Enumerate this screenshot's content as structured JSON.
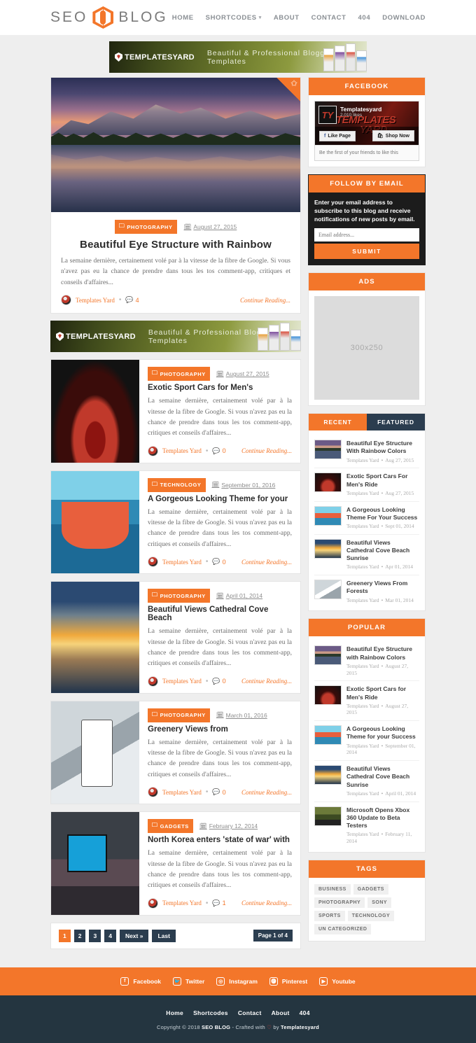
{
  "header": {
    "logo_left": "SEO",
    "logo_right": "BLOG",
    "logo_icon": "hexagon-icon",
    "nav": [
      {
        "label": "HOME",
        "has_caret": false
      },
      {
        "label": "SHORTCODES",
        "has_caret": true
      },
      {
        "label": "ABOUT",
        "has_caret": false
      },
      {
        "label": "CONTACT",
        "has_caret": false
      },
      {
        "label": "404",
        "has_caret": false
      },
      {
        "label": "DOWNLOAD",
        "has_caret": false
      }
    ]
  },
  "banner": {
    "brand": "TEMPLATESYARD",
    "tagline": "Beautiful & Professional Blogger Templates"
  },
  "featured_post": {
    "badge_icon": "star-icon",
    "category": "PHOTOGRAPHY",
    "date": "August 27, 2015",
    "title": "Beautiful Eye Structure with Rainbow",
    "excerpt": "La semaine dernière, certainement volé par à la vitesse de la fibre de Google. Si vous n'avez pas eu la chance de prendre dans tous les tos comment-app, critiques et conseils d'affaires...",
    "author": "Templates Yard",
    "comments": "4",
    "continue": "Continue Reading..."
  },
  "posts": [
    {
      "category": "PHOTOGRAPHY",
      "date": "August 27, 2015",
      "title": "Exotic Sport Cars for Men's",
      "excerpt": "La semaine dernière, certainement volé par à la vitesse de la fibre de Google. Si vous n'avez pas eu la chance de prendre dans tous les tos comment-app, critiques et conseils d'affaires...",
      "author": "Templates Yard",
      "comments": "0",
      "continue": "Continue Reading...",
      "thumb": "th-car"
    },
    {
      "category": "TECHNOLOGY",
      "date": "September 01, 2016",
      "title": "A Gorgeous Looking Theme for your",
      "excerpt": "La semaine dernière, certainement volé par à la vitesse de la fibre de Google. Si vous n'avez pas eu la chance de prendre dans tous les tos comment-app, critiques et conseils d'affaires...",
      "author": "Templates Yard",
      "comments": "0",
      "continue": "Continue Reading...",
      "thumb": "th-boat"
    },
    {
      "category": "PHOTOGRAPHY",
      "date": "April 01, 2014",
      "title": "Beautiful Views Cathedral Cove Beach",
      "excerpt": "La semaine dernière, certainement volé par à la vitesse de la fibre de Google. Si vous n'avez pas eu la chance de prendre dans tous les tos comment-app, critiques et conseils d'affaires...",
      "author": "Templates Yard",
      "comments": "0",
      "continue": "Continue Reading...",
      "thumb": "th-sun"
    },
    {
      "category": "PHOTOGRAPHY",
      "date": "March 01, 2016",
      "title": "Greenery Views from",
      "excerpt": "La semaine dernière, certainement volé par à la vitesse de la fibre de Google. Si vous n'avez pas eu la chance de prendre dans tous les tos comment-app, critiques et conseils d'affaires...",
      "author": "Templates Yard",
      "comments": "0",
      "continue": "Continue Reading...",
      "thumb": "th-phone"
    },
    {
      "category": "GADGETS",
      "date": "February 12, 2014",
      "title": "North Korea enters 'state of war' with",
      "excerpt": "La semaine dernière, certainement volé par à la vitesse de la fibre de Google. Si vous n'avez pas eu la chance de prendre dans tous les tos comment-app, critiques et conseils d'affaires...",
      "author": "Templates Yard",
      "comments": "1",
      "continue": "Continue Reading...",
      "thumb": "th-room"
    }
  ],
  "pagination": {
    "pages": [
      "1",
      "2",
      "3",
      "4"
    ],
    "next_label": "Next »",
    "last_label": "Last",
    "status": "Page 1 of 4",
    "active_page": "1"
  },
  "sidebar": {
    "facebook": {
      "title": "FACEBOOK",
      "page_name": "Templatesyard",
      "likes": "2,010 likes",
      "cover_text_1": "TEMPLATES",
      "cover_text_2": "YARD.",
      "like_button": "Like Page",
      "shop_button": "Shop Now",
      "footer_note": "Be the first of your friends to like this"
    },
    "follow_email": {
      "title": "FOLLOW BY EMAIL",
      "description": "Enter your email address to subscribe to this blog and receive notifications of new posts by email.",
      "input_placeholder": "Email address...",
      "submit_label": "SUBMIT"
    },
    "ads": {
      "title": "ADS",
      "placeholder": "300x250"
    },
    "tabs": {
      "recent_label": "RECENT",
      "featured_label": "FEATURED",
      "active": "RECENT",
      "items": [
        {
          "title": "Beautiful Eye Structure With Rainbow Colors",
          "author": "Templates Yard",
          "date": "Aug 27, 2015",
          "thumb": "mt-mountain"
        },
        {
          "title": "Exotic Sport Cars For Men's Ride",
          "author": "Templates Yard",
          "date": "Aug 27, 2015",
          "thumb": "mt-car"
        },
        {
          "title": "A Gorgeous Looking Theme For Your Success",
          "author": "Templates Yard",
          "date": "Sept 01, 2014",
          "thumb": "mt-boat"
        },
        {
          "title": "Beautiful Views Cathedral Cove Beach Sunrise",
          "author": "Templates Yard",
          "date": "Apr 01, 2014",
          "thumb": "mt-sun"
        },
        {
          "title": "Greenery Views From Forests",
          "author": "Templates Yard",
          "date": "Mar 01, 2014",
          "thumb": "mt-phone"
        }
      ]
    },
    "popular": {
      "title": "POPULAR",
      "items": [
        {
          "title": "Beautiful Eye Structure with Rainbow Colors",
          "author": "Templates Yard",
          "date": "August 27, 2015",
          "thumb": "mt-mountain"
        },
        {
          "title": "Exotic Sport Cars for Men's Ride",
          "author": "Templates Yard",
          "date": "August 27, 2015",
          "thumb": "mt-car"
        },
        {
          "title": "A Gorgeous Looking Theme for your Success",
          "author": "Templates Yard",
          "date": "September 01, 2014",
          "thumb": "mt-boat"
        },
        {
          "title": "Beautiful Views Cathedral Cove Beach Sunrise",
          "author": "Templates Yard",
          "date": "April 01, 2014",
          "thumb": "mt-sun"
        },
        {
          "title": "Microsoft Opens Xbox 360 Update to Beta Testers",
          "author": "Templates Yard",
          "date": "February 11, 2014",
          "thumb": "mt-xbox"
        }
      ]
    },
    "tags": {
      "title": "TAGS",
      "items": [
        "BUSINESS",
        "GADGETS",
        "PHOTOGRAPHY",
        "SONY",
        "SPORTS",
        "TECHNOLOGY",
        "UN CATEGORIZED"
      ]
    }
  },
  "footer": {
    "social": [
      {
        "label": "Facebook",
        "icon": "facebook-icon"
      },
      {
        "label": "Twitter",
        "icon": "twitter-icon"
      },
      {
        "label": "Instagram",
        "icon": "instagram-icon"
      },
      {
        "label": "Pinterest",
        "icon": "pinterest-icon"
      },
      {
        "label": "Youtube",
        "icon": "youtube-icon"
      }
    ],
    "nav": [
      "Home",
      "Shortcodes",
      "Contact",
      "About",
      "404"
    ],
    "copyright_pre": "Copyright © 2018 ",
    "copyright_brand": "SEO BLOG",
    "copyright_mid": " - Crafted with ",
    "copyright_by": " by ",
    "copyright_author": "Templatesyard"
  },
  "colors": {
    "accent": "#f3762a",
    "dark": "#243540",
    "navy": "#2b3d4f"
  }
}
